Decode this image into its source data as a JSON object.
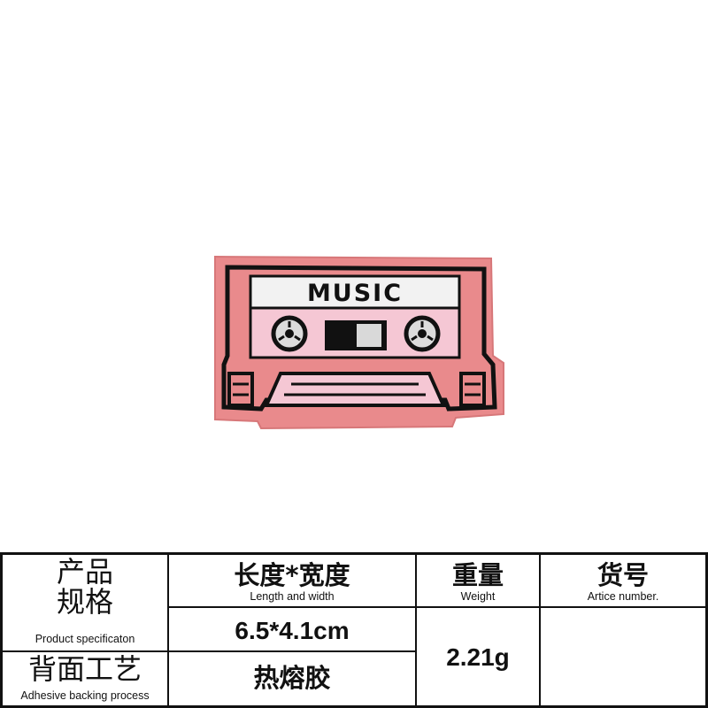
{
  "product": {
    "patch_text": "MUSIC",
    "colors": {
      "patch_body": "#e98a8c",
      "patch_label": "#f2f2f2",
      "patch_window": "#f5c7d4",
      "outline": "#111111"
    }
  },
  "table": {
    "spec_label_zh_1": "产品",
    "spec_label_zh_2": "规格",
    "spec_label_en": "Product specificaton",
    "size_header_zh": "长度*宽度",
    "size_header_en": "Length and width",
    "weight_header_zh": "重量",
    "weight_header_en": "Weight",
    "article_header_zh": "货号",
    "article_header_en": "Artice number.",
    "size_value": "6.5*4.1cm",
    "weight_value": "2.21g",
    "article_value": "",
    "backing_label_zh": "背面工艺",
    "backing_label_en": "Adhesive backing process",
    "backing_value": "热熔胶"
  }
}
